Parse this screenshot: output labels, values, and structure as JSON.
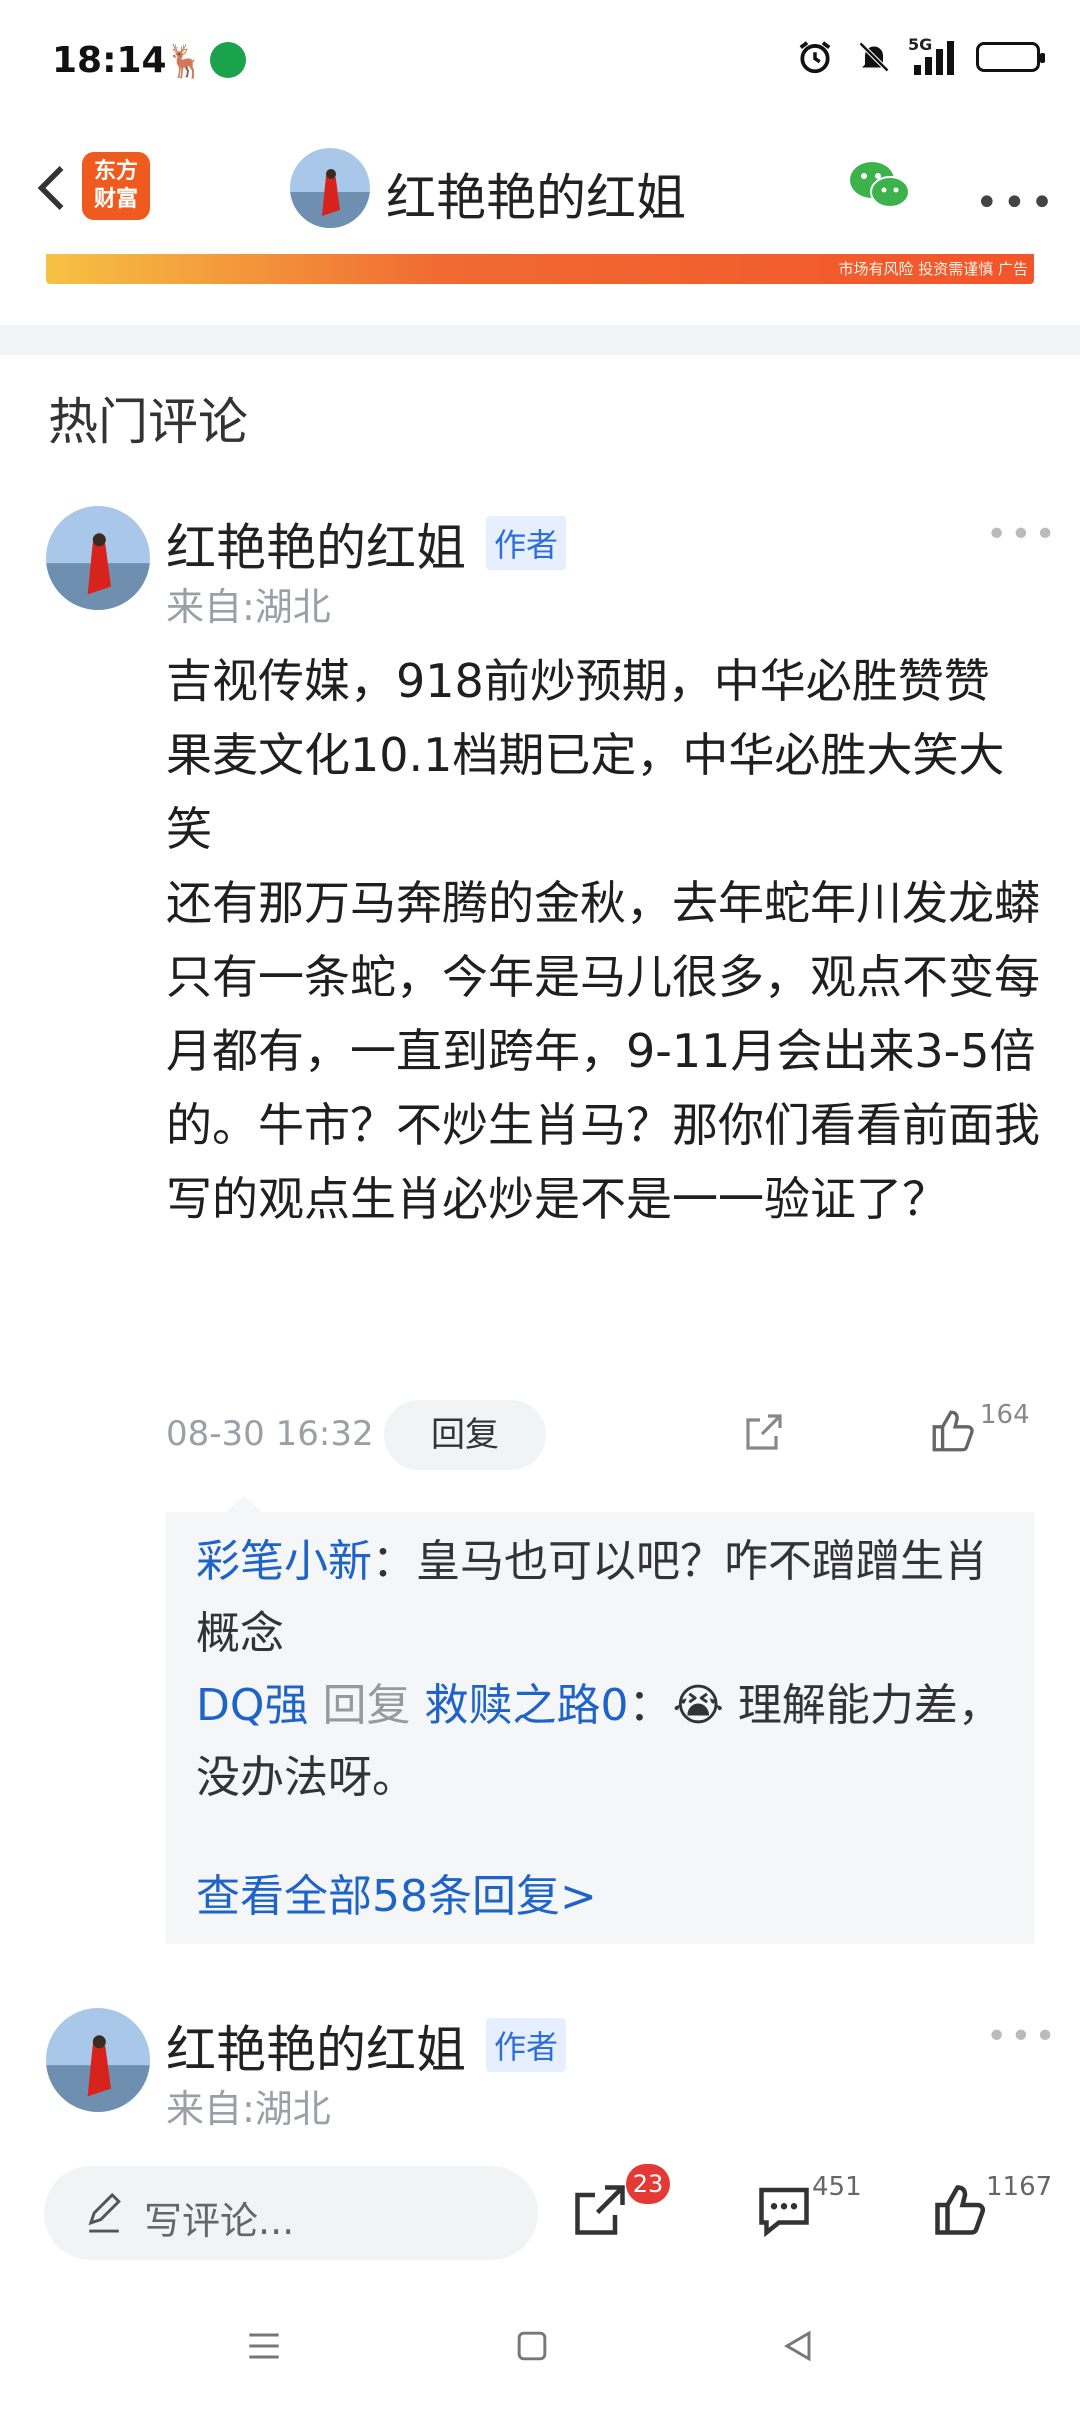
{
  "status_bar": {
    "time": "18:14",
    "network": "5G",
    "icons": [
      "alarm-icon",
      "mute-icon",
      "signal-icon",
      "battery-icon"
    ]
  },
  "navbar": {
    "logo_line1": "东方",
    "logo_line2": "财富",
    "title": "红艳艳的红姐",
    "more": "•••"
  },
  "banner": {
    "text": "市场有风险 投资需谨慎 广告"
  },
  "section_title": "热门评论",
  "comments": [
    {
      "author": "红艳艳的红姐",
      "tag": "作者",
      "location": "来自:湖北",
      "body": "吉视传媒，918前炒预期，中华必胜赞赞\n果麦文化10.1档期已定，中华必胜大笑大笑\n还有那万马奔腾的金秋，去年蛇年川发龙蟒只有一条蛇，今年是马儿很多，观点不变每月都有，一直到跨年，9-11月会出来3-5倍的。牛市？不炒生肖马？那你们看看前面我写的观点生肖必炒是不是一一验证了？",
      "time": "08-30 16:32",
      "reply_label": "回复",
      "likes": "164",
      "replies": [
        {
          "name": "彩笔小新",
          "text": "：皇马也可以吧？咋不蹭蹭生肖概念"
        },
        {
          "name": "DQ强",
          "reply_word": "回复",
          "target": "救赎之路0",
          "colon": "：",
          "emoji": "😭",
          "text": " 理解能力差，没办法呀。"
        }
      ],
      "view_all": "查看全部58条回复>"
    },
    {
      "author": "红艳艳的红姐",
      "tag": "作者",
      "location": "来自:湖北"
    }
  ],
  "bottom_bar": {
    "input_placeholder": "写评论...",
    "share_badge": "23",
    "comment_count": "451",
    "like_count": "1167"
  },
  "colors": {
    "link_blue": "#1e63c8",
    "brand_orange": "#ef5a1e",
    "badge_red": "#e53935"
  }
}
